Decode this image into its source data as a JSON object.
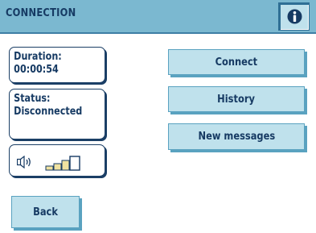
{
  "header": {
    "title": "CONNECTION",
    "info_icon": "info-icon"
  },
  "status_panel": {
    "duration_label": "Duration:",
    "duration_value": "00:00:54",
    "status_label": "Status:",
    "status_value": "Disconnected"
  },
  "signal": {
    "speaker_icon": "speaker-icon",
    "bars_icon": "signal-strength-icon",
    "bars_total": 4
  },
  "actions": {
    "connect_label": "Connect",
    "history_label": "History",
    "new_messages_label": "New messages"
  },
  "footer": {
    "back_label": "Back"
  },
  "colors": {
    "header_bg": "#7bb8d0",
    "button_bg": "#bfe1ec",
    "text": "#163a63",
    "signal_fill": "#f0e2a0"
  }
}
